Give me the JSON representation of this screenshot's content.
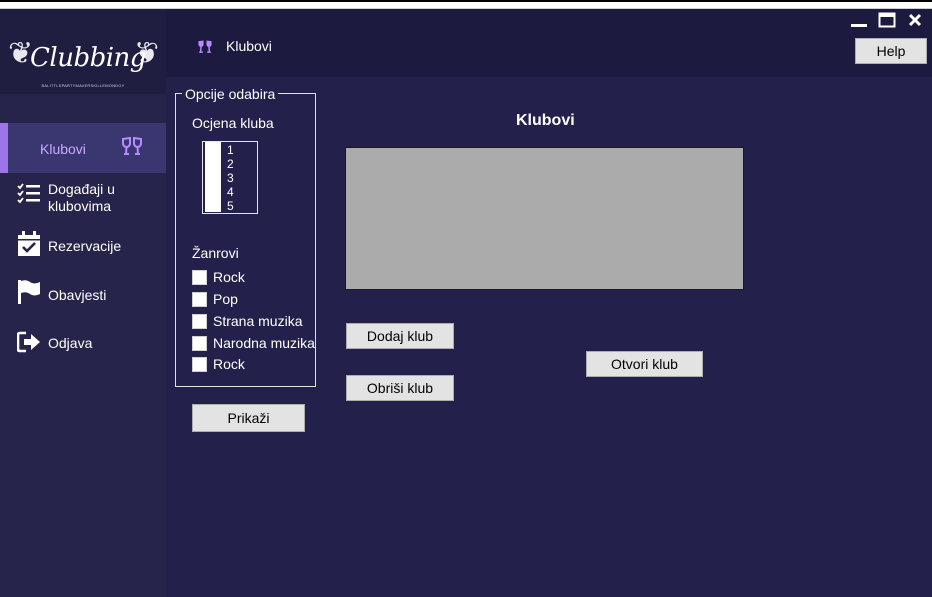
{
  "app": {
    "logo_text": "Clubbing",
    "logo_tagline": "BALITTLEPARTYMAVERSKILLEMONDOY"
  },
  "sidebar": {
    "items": [
      {
        "label": "Klubovi",
        "icon": "cheers-glasses-icon",
        "active": true
      },
      {
        "label": "Događaji u klubovima",
        "icon": "checklist-icon",
        "active": false
      },
      {
        "label": "Rezervacije",
        "icon": "calendar-check-icon",
        "active": false
      },
      {
        "label": "Obavjesti",
        "icon": "flag-icon",
        "active": false
      },
      {
        "label": "Odjava",
        "icon": "sign-out-icon",
        "active": false
      }
    ],
    "active_accent": "#9e75e8"
  },
  "header": {
    "title": "Klubovi",
    "icon": "cheers-glasses-icon",
    "help_label": "Help",
    "window_controls": [
      "minimize-icon",
      "maximize-icon",
      "close-icon"
    ]
  },
  "filters": {
    "group_title": "Opcije odabira",
    "rating_label": "Ocjena kluba",
    "ratings": [
      "1",
      "2",
      "3",
      "4",
      "5"
    ],
    "genres_label": "Žanrovi",
    "genres": [
      "Rock",
      "Pop",
      "Strana muzika",
      "Narodna muzika",
      "Rock"
    ],
    "show_label": "Prikaži"
  },
  "main": {
    "heading": "Klubovi",
    "add_label": "Dodaj klub",
    "delete_label": "Obriši klub",
    "open_label": "Otvori klub"
  },
  "colors": {
    "sidebar_bg": "#26244a",
    "header_bg": "#1c1a3e",
    "content_bg": "#23214b",
    "accent": "#9e75e8",
    "grid_bg": "#ababab"
  }
}
